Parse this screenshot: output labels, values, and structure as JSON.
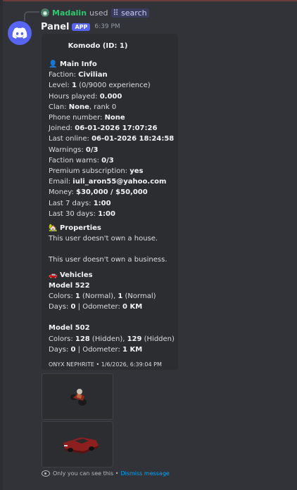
{
  "reply": {
    "user": "Madalin",
    "used": "used",
    "command_icon": "⠿",
    "command": "search"
  },
  "message": {
    "author": "Panel",
    "tag": "APP",
    "time": "6:39 PM"
  },
  "embed": {
    "title": "Komodo (ID: 1)",
    "main_info": {
      "icon": "👤",
      "heading": "Main Info",
      "faction_label": "Faction: ",
      "faction": "Civilian",
      "level_label": "Level: ",
      "level": "1",
      "level_suffix": " (0/9000 experience)",
      "hours_label": "Hours played: ",
      "hours": "0.000",
      "clan_label": "Clan: ",
      "clan": "None",
      "clan_suffix": ", rank 0",
      "phone_label": "Phone number: ",
      "phone": "None",
      "joined_label": "Joined: ",
      "joined": "06-01-2026 17:07:26",
      "last_online_label": "Last online: ",
      "last_online": "06-01-2026 18:24:58",
      "warnings_label": "Warnings: ",
      "warnings": "0/3",
      "faction_warns_label": "Faction warns: ",
      "faction_warns": "0/3",
      "premium_label": "Premium subscription: ",
      "premium": "yes",
      "email_label": "Email: ",
      "email": "iuli_aron55@yahoo.com",
      "money_label": "Money: ",
      "money": "$30,000 / $50,000",
      "last7_label": "Last 7 days: ",
      "last7": "1:00",
      "last30_label": "Last 30 days: ",
      "last30": "1:00"
    },
    "properties": {
      "icon": "🏡",
      "heading": "Properties",
      "house": "This user doesn't own a house.",
      "business": "This user doesn't own a business."
    },
    "vehicles": {
      "icon": "🚗",
      "heading": "Vehicles",
      "items": [
        {
          "model": "Model 522",
          "colors_label": "Colors: ",
          "c1": "1",
          "c1n": " (Normal), ",
          "c2": "1",
          "c2n": " (Normal)",
          "days_label": "Days: ",
          "days": "0",
          "odo_label": " | Odometer: ",
          "odo": "0 KM"
        },
        {
          "model": "Model 502",
          "colors_label": "Colors: ",
          "c1": "128",
          "c1n": " (Hidden), ",
          "c2": "129",
          "c2n": " (Hidden)",
          "days_label": "Days: ",
          "days": "0",
          "odo_label": " | Odometer: ",
          "odo": "1 KM"
        }
      ]
    },
    "footer": "ONYX NEPHRITE • 1/6/2026, 6:39:04 PM"
  },
  "attachments": [
    {
      "icon": "motorcycle-icon"
    },
    {
      "icon": "car-icon"
    }
  ],
  "ephemeral": {
    "text": "Only you can see this • ",
    "dismiss": "Dismiss message"
  },
  "colors": {
    "background": "#313338",
    "embed": "#2b2d31",
    "blurple": "#5865f2",
    "link": "#00a8fc",
    "user_green": "#2dc770"
  }
}
